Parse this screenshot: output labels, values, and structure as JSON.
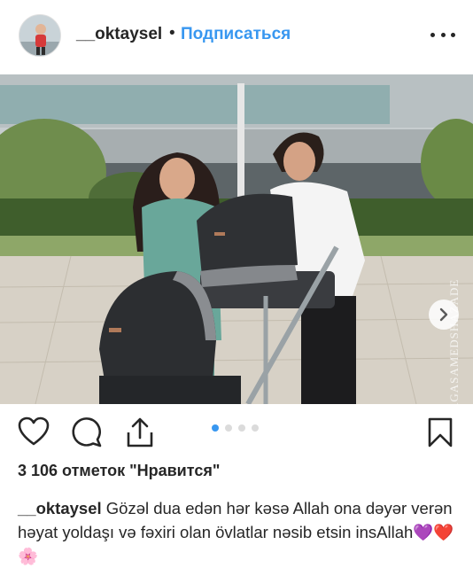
{
  "post": {
    "username": "__oktaysel",
    "separator": "•",
    "follow_label": "Подписаться",
    "watermark": "AGASAMEDSHAZADE",
    "likes_text": "3 106 отметок \"Нравится\"",
    "caption_user": "__oktaysel",
    "caption_text": " Gözəl dua edən hər kəsə Allah ona dəyər verən həyat yoldaşı və fəxiri olan övlatlar nəsib etsin insAllah💜❤️🌸"
  },
  "carousel": {
    "count": 4,
    "active_index": 0
  },
  "icons": [
    "more-icon",
    "next-arrow-icon",
    "heart-icon",
    "comment-icon",
    "share-icon",
    "bookmark-icon"
  ],
  "colors": {
    "accent": "#3897f0",
    "text": "#262626",
    "inactive_dot": "#dbdbdb"
  }
}
